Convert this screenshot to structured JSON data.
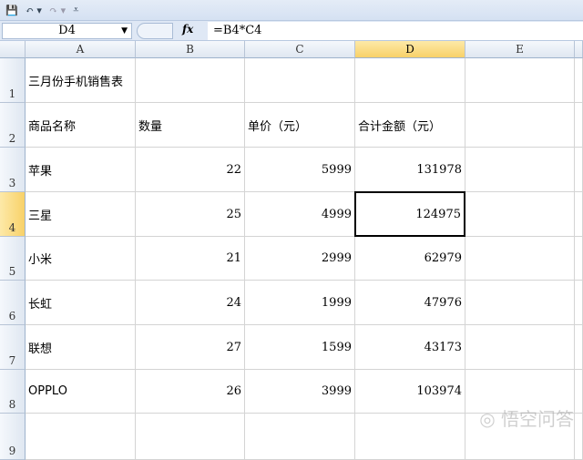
{
  "toolbar": {
    "save": "💾",
    "undo": "↶ ▾",
    "redo": "↷ ▾",
    "customize": "⩡"
  },
  "formula_bar": {
    "name_box": "D4",
    "fx": "fx",
    "formula": "=B4*C4"
  },
  "columns": [
    "A",
    "B",
    "C",
    "D",
    "E"
  ],
  "rows": [
    {
      "n": "1",
      "cells": [
        "三月份手机销售表",
        "",
        "",
        "",
        ""
      ]
    },
    {
      "n": "2",
      "cells": [
        "商品名称",
        "数量",
        "单价（元）",
        "合计金额（元）",
        ""
      ]
    },
    {
      "n": "3",
      "cells": [
        "苹果",
        "22",
        "5999",
        "131978",
        ""
      ]
    },
    {
      "n": "4",
      "cells": [
        "三星",
        "25",
        "4999",
        "124975",
        ""
      ]
    },
    {
      "n": "5",
      "cells": [
        "小米",
        "21",
        "2999",
        "62979",
        ""
      ]
    },
    {
      "n": "6",
      "cells": [
        "长虹",
        "24",
        "1999",
        "47976",
        ""
      ]
    },
    {
      "n": "7",
      "cells": [
        "联想",
        "27",
        "1599",
        "43173",
        ""
      ]
    },
    {
      "n": "8",
      "cells": [
        "OPPLO",
        "26",
        "3999",
        "103974",
        ""
      ]
    },
    {
      "n": "9",
      "cells": [
        "",
        "",
        "",
        "",
        ""
      ]
    }
  ],
  "selected": {
    "row": 4,
    "col": "D"
  },
  "watermark": "悟空问答"
}
